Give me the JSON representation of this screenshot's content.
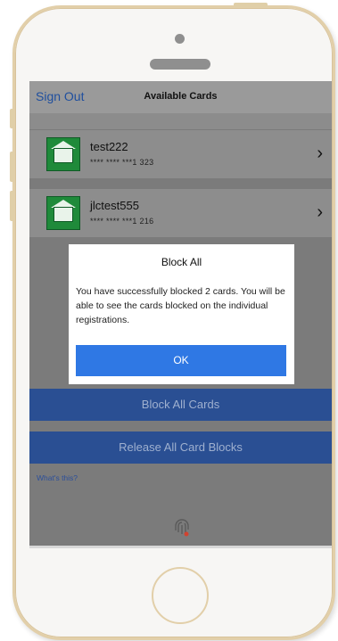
{
  "header": {
    "sign_out_label": "Sign Out",
    "title": "Available Cards"
  },
  "cards": [
    {
      "name": "test222",
      "number": "**** **** ***1 323"
    },
    {
      "name": "jlctest555",
      "number": "**** **** ***1 216"
    }
  ],
  "dialog": {
    "title": "Block All",
    "message": "You have successfully blocked 2 cards. You will be able to see the cards blocked on the individual registrations.",
    "ok_label": "OK"
  },
  "actions": {
    "block_all_label": "Block All Cards",
    "release_all_label": "Release All Card Blocks"
  },
  "help": {
    "whats_this_label": "What's this?"
  },
  "colors": {
    "primary_blue": "#2f78e4",
    "action_blue": "#2a4f93",
    "card_icon_green": "#1f8a3a",
    "phone_gold": "#e2cfa9"
  },
  "icons": {
    "card_icon": "bank-house-icon",
    "row_arrow": "chevron-right-icon",
    "bottom": "fingerprint-icon"
  }
}
